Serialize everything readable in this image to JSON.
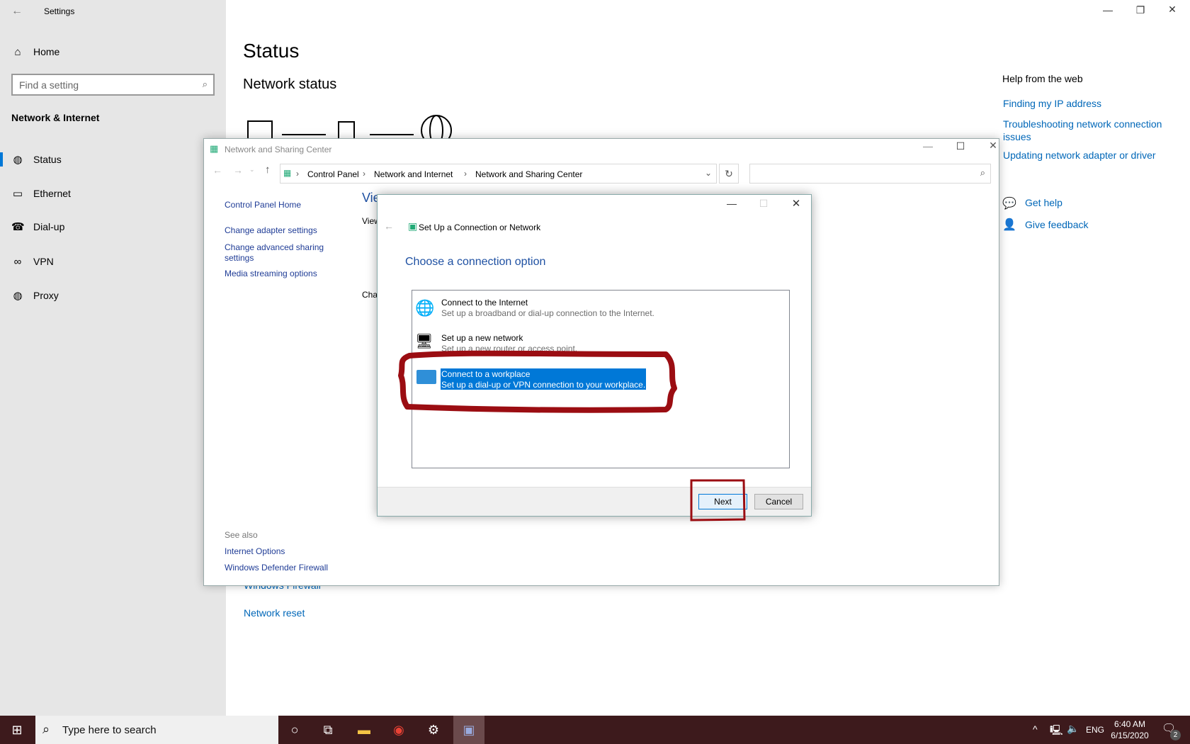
{
  "settings": {
    "title": "Settings",
    "home": "Home",
    "search_placeholder": "Find a setting",
    "section": "Network & Internet",
    "nav": [
      {
        "label": "Status",
        "icon": "globe-icon"
      },
      {
        "label": "Ethernet",
        "icon": "ethernet-icon"
      },
      {
        "label": "Dial-up",
        "icon": "dialup-icon"
      },
      {
        "label": "VPN",
        "icon": "vpn-icon"
      },
      {
        "label": "Proxy",
        "icon": "globe-icon"
      }
    ],
    "page_title": "Status",
    "subtitle": "Network status",
    "behind_link": "Windows Firewall",
    "network_reset": "Network reset",
    "help": {
      "title": "Help from the web",
      "links": [
        "Finding my IP address",
        "Troubleshooting network connection issues",
        "Updating network adapter or driver"
      ],
      "get_help": "Get help",
      "give_feedback": "Give feedback"
    }
  },
  "nsc": {
    "title": "Network and Sharing Center",
    "breadcrumb": [
      "Control Panel",
      "Network and Internet",
      "Network and Sharing Center"
    ],
    "left_links": [
      "Control Panel Home",
      "Change adapter settings",
      "Change advanced sharing settings",
      "Media streaming options"
    ],
    "see_also": "See also",
    "see_also_links": [
      "Internet Options",
      "Windows Defender Firewall"
    ],
    "partial": [
      "Vie",
      "View",
      "Cha"
    ]
  },
  "dialog": {
    "title": "Set Up a Connection or Network",
    "heading": "Choose a connection option",
    "options": [
      {
        "title": "Connect to the Internet",
        "desc": "Set up a broadband or dial-up connection to the Internet."
      },
      {
        "title": "Set up a new network",
        "desc": "Set up a new router or access point."
      },
      {
        "title": "Connect to a workplace",
        "desc": "Set up a dial-up or VPN connection to your workplace.",
        "selected": true
      }
    ],
    "next": "Next",
    "cancel": "Cancel"
  },
  "taskbar": {
    "search_placeholder": "Type here to search",
    "lang": "ENG",
    "time": "6:40 AM",
    "date": "6/15/2020",
    "notifications": "2"
  },
  "colors": {
    "accent": "#0078d7",
    "annotation": "#9b0d12",
    "taskbar": "#3d1a1c"
  }
}
